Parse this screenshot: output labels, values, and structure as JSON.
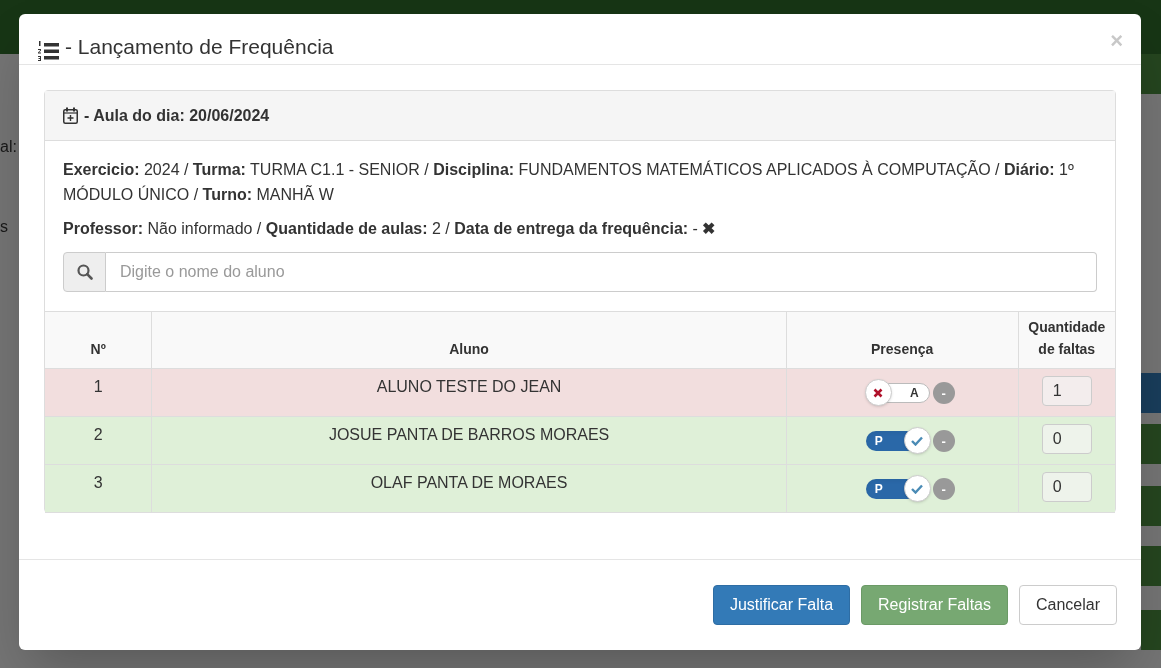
{
  "background_fragments": [
    {
      "text": "al:",
      "kind": "label"
    },
    {
      "text": "s",
      "kind": "label"
    },
    {
      "kind": "button"
    },
    {
      "kind": "primary"
    },
    {
      "kind": "button"
    },
    {
      "kind": "button"
    },
    {
      "kind": "button"
    },
    {
      "kind": "button"
    }
  ],
  "modal": {
    "title": "- Lançamento de Frequência",
    "close": "×",
    "panel": {
      "heading": "- Aula do dia: 20/06/2024",
      "info": [
        "**Exercicio:** 2024 / **Turma:** TURMA C1.1 - SENIOR / **Disciplina:** FUNDAMENTOS MATEMÁTICOS APLICADOS À COMPUTAÇÃO / **Diário:** 1º MÓDULO ÚNICO / **Turno:** MANHÃ W",
        "**Professor:** Não informado / **Quantidade de aulas:** 2 / **Data de entrega da frequência:** - **✖**"
      ],
      "search": {
        "placeholder": "Digite o nome do aluno"
      },
      "table": {
        "columns": [
          "Nº",
          "Aluno",
          "Presença",
          "Quantidade de faltas"
        ],
        "rows": [
          {
            "number": "1",
            "name": "ALUNO TESTE DO JEAN",
            "present": false,
            "toggle_label": "A",
            "clear": "-",
            "absences": "1"
          },
          {
            "number": "2",
            "name": "JOSUE PANTA DE BARROS MORAES",
            "present": true,
            "toggle_label": "P",
            "clear": "-",
            "absences": "0"
          },
          {
            "number": "3",
            "name": "OLAF PANTA DE MORAES",
            "present": true,
            "toggle_label": "P",
            "clear": "-",
            "absences": "0"
          }
        ]
      }
    },
    "buttons": [
      {
        "label": "Justificar Falta",
        "kind": "primary"
      },
      {
        "label": "Registrar Faltas",
        "kind": "success"
      },
      {
        "label": "Cancelar",
        "kind": "default"
      }
    ]
  }
}
